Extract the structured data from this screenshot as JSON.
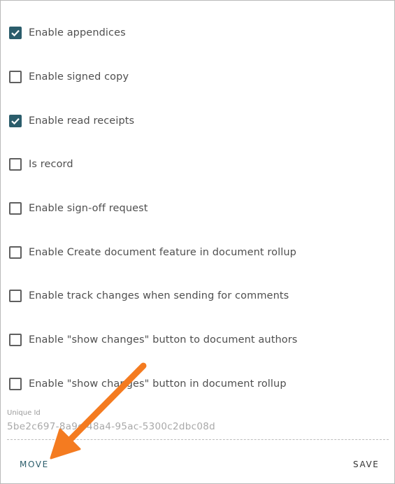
{
  "settings": [
    {
      "label": "Enable appendices",
      "checked": true
    },
    {
      "label": "Enable signed copy",
      "checked": false
    },
    {
      "label": "Enable read receipts",
      "checked": true
    },
    {
      "label": "Is record",
      "checked": false
    },
    {
      "label": "Enable sign-off request",
      "checked": false
    },
    {
      "label": "Enable Create document feature in document rollup",
      "checked": false
    },
    {
      "label": "Enable track changes when sending for comments",
      "checked": false
    },
    {
      "label": "Enable \"show changes\" button to document authors",
      "checked": false
    },
    {
      "label": "Enable \"show changes\" button in document rollup",
      "checked": false
    }
  ],
  "unique_id": {
    "label": "Unique Id",
    "value": "5be2c697-8a9c-48a4-95ac-5300c2dbc08d"
  },
  "actions": {
    "move_label": "MOVE",
    "save_label": "SAVE"
  },
  "colors": {
    "accent": "#2b5d6b",
    "annotation_arrow": "#f47b20"
  }
}
